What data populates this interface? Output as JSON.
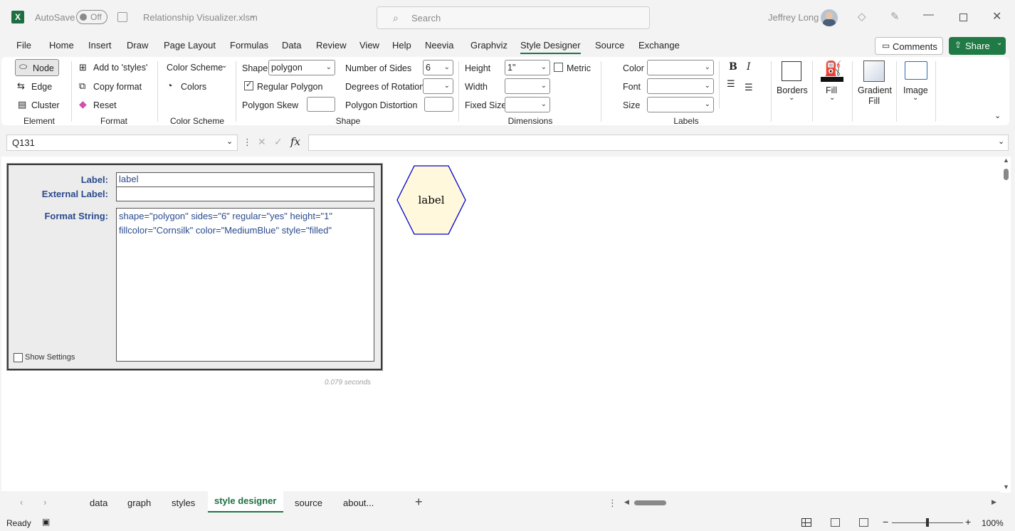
{
  "app": {
    "autosave_label": "AutoSave",
    "autosave_state": "Off",
    "file_name": "Relationship Visualizer.xlsm",
    "search_placeholder": "Search",
    "user_name": "Jeffrey Long"
  },
  "menu": [
    "File",
    "Home",
    "Insert",
    "Draw",
    "Page Layout",
    "Formulas",
    "Data",
    "Review",
    "View",
    "Help",
    "Neevia",
    "Graphviz",
    "Style Designer",
    "Source",
    "Exchange"
  ],
  "menu_active": "Style Designer",
  "comments_label": "Comments",
  "share_label": "Share",
  "ribbon": {
    "element": {
      "node": "Node",
      "edge": "Edge",
      "cluster": "Cluster",
      "group": "Element"
    },
    "format": {
      "add": "Add to 'styles'",
      "copy": "Copy format",
      "reset": "Reset",
      "group": "Format"
    },
    "color_scheme": {
      "label": "Color Scheme",
      "colors": "Colors",
      "group": "Color Scheme"
    },
    "shape": {
      "shape_label": "Shape",
      "shape_value": "polygon",
      "regular_polygon": "Regular Polygon",
      "regular_checked": true,
      "polygon_skew": "Polygon Skew",
      "sides_label": "Number of Sides",
      "sides_value": "6",
      "rotation_label": "Degrees of Rotation",
      "distortion_label": "Polygon Distortion",
      "group": "Shape"
    },
    "dimensions": {
      "height_label": "Height",
      "height_value": "1\"",
      "width_label": "Width",
      "fixed_label": "Fixed Size",
      "metric_label": "Metric",
      "group": "Dimensions"
    },
    "labels": {
      "color": "Color",
      "font": "Font",
      "size": "Size",
      "group": "Labels"
    },
    "borders": "Borders",
    "fill": "Fill",
    "gradient_fill": "Gradient Fill",
    "image": "Image"
  },
  "formula_bar": {
    "cell": "Q131",
    "formula": ""
  },
  "panel": {
    "label_label": "Label:",
    "label_value": "label",
    "ext_label_label": "External Label:",
    "ext_label_value": "",
    "format_label": "Format String:",
    "format_line1": "shape=\"polygon\" sides=\"6\" regular=\"yes\" height=\"1\"",
    "format_line2": "fillcolor=\"Cornsilk\" color=\"MediumBlue\" style=\"filled\"",
    "show_settings": "Show Settings",
    "timing": "0.079 seconds"
  },
  "preview": {
    "text": "label",
    "fill": "#FFF8DC",
    "stroke": "#0000CD"
  },
  "sheets": [
    "data",
    "graph",
    "styles",
    "style designer",
    "source",
    "about..."
  ],
  "active_sheet": "style designer",
  "status": {
    "ready": "Ready",
    "zoom": "100%"
  },
  "colors": {
    "excel_green": "#217346",
    "accent_blue": "#2b4b8c"
  }
}
